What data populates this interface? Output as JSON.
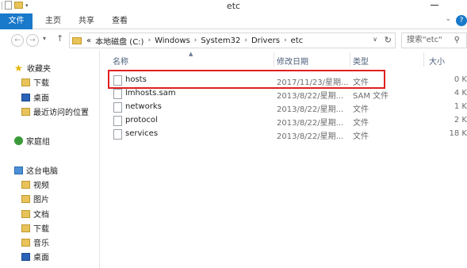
{
  "window": {
    "title": "etc"
  },
  "ribbon": {
    "tabs": [
      "文件",
      "主页",
      "共享",
      "查看"
    ],
    "help": "?"
  },
  "address": {
    "overflow": "«",
    "crumbs": [
      "本地磁盘 (C:)",
      "Windows",
      "System32",
      "Drivers",
      "etc"
    ],
    "separator": "›"
  },
  "search": {
    "placeholder": "搜索\"etc\""
  },
  "nav": {
    "favorites": {
      "label": "收藏夹",
      "items": [
        "下载",
        "桌面",
        "最近访问的位置"
      ]
    },
    "homegroup": "家庭组",
    "thispc": {
      "label": "这台电脑",
      "items": [
        "视频",
        "图片",
        "文档",
        "下载",
        "音乐",
        "桌面"
      ]
    }
  },
  "columns": {
    "name": "名称",
    "modified": "修改日期",
    "type": "类型",
    "size": "大小"
  },
  "files": [
    {
      "name": "hosts",
      "modified": "2017/11/23/星期...",
      "type": "文件",
      "size": "0 K",
      "highlighted": true
    },
    {
      "name": "lmhosts.sam",
      "modified": "2013/8/22/星期...",
      "type": "SAM 文件",
      "size": "4 K"
    },
    {
      "name": "networks",
      "modified": "2013/8/22/星期...",
      "type": "文件",
      "size": "1 K"
    },
    {
      "name": "protocol",
      "modified": "2013/8/22/星期...",
      "type": "文件",
      "size": "2 K"
    },
    {
      "name": "services",
      "modified": "2013/8/22/星期...",
      "type": "文件",
      "size": "18 K"
    }
  ],
  "colors": {
    "accent": "#1979ca",
    "highlight": "#e02020",
    "header_text": "#4c607a"
  }
}
